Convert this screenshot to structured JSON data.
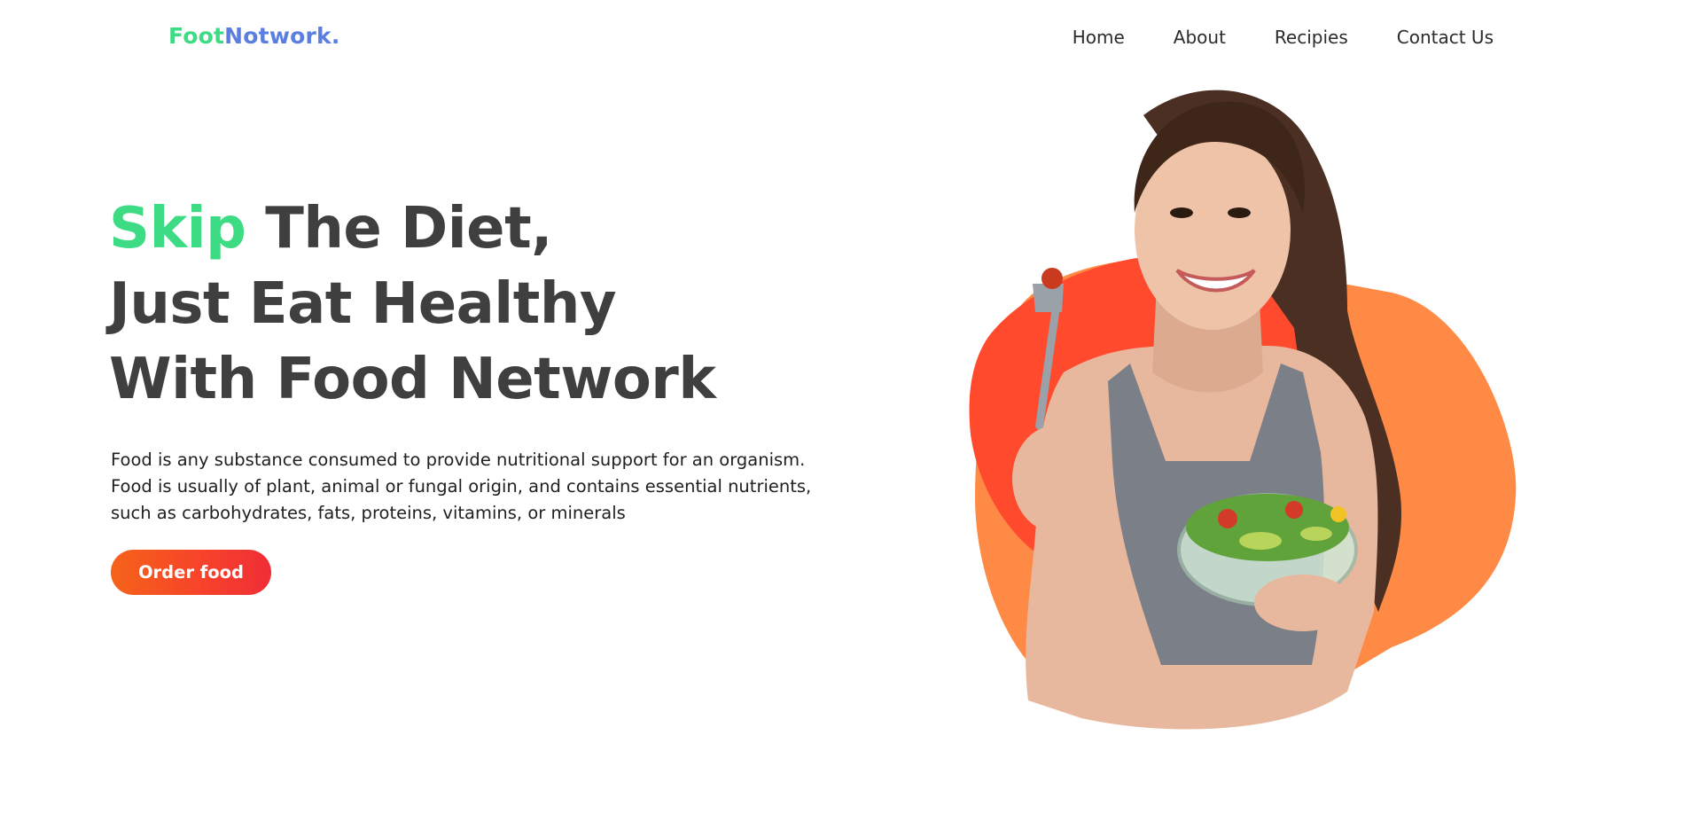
{
  "header": {
    "logo_part1": "Foot",
    "logo_part2": "Notwork.",
    "nav": [
      {
        "label": "Home"
      },
      {
        "label": "About"
      },
      {
        "label": "Recipies"
      },
      {
        "label": "Contact Us"
      }
    ]
  },
  "hero": {
    "title_accent": "Skip",
    "title_line1_rest": " The Diet,",
    "title_line2": "Just Eat Healthy",
    "title_line3": "With Food Network",
    "description": "Food is any substance consumed to provide nutritional support for an organism. Food is usually of plant, animal or fungal origin, and contains essential nutrients, such as carbohydrates, fats, proteins, vitamins, or minerals",
    "cta_label": "Order food",
    "image_icon": "woman-eating-salad-image"
  },
  "colors": {
    "accent_green": "#3ddc84",
    "accent_blue": "#5b7fe0",
    "text_dark": "#3f3f3f",
    "button_start": "#f5631a",
    "button_end": "#ef2d36",
    "blob_orange": "#ff8a45",
    "blob_red": "#ff4a2e"
  }
}
